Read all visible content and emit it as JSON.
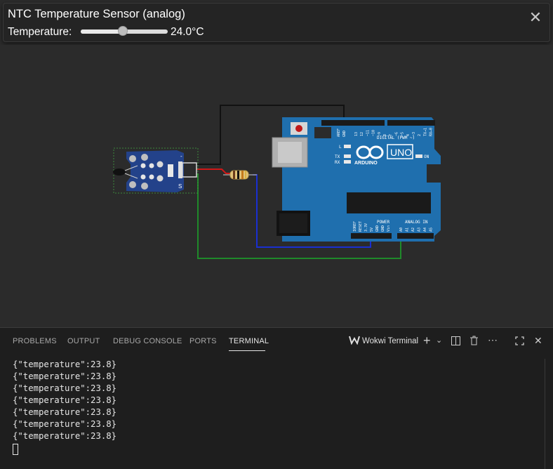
{
  "popup": {
    "title": "NTC Temperature Sensor (analog)",
    "temperature_label": "Temperature:",
    "temperature_value": "24.0°C",
    "slider_fraction": 0.48,
    "close_icon": "close-icon"
  },
  "board": {
    "brand": "ARDUINO",
    "model": "UNO",
    "digital_label": "DIGITAL (PWM ~)",
    "analog_label": "ANALOG IN",
    "power_label": "POWER",
    "aref": "AREF",
    "gnd": "GND",
    "led_l": "L",
    "led_tx": "TX",
    "led_rx": "RX",
    "on_label": "ON",
    "digital_pins": [
      "13",
      "12",
      "~11",
      "~10",
      "~9",
      "8",
      "7",
      "~6",
      "~5",
      "4",
      "~3",
      "2",
      "TX→1",
      "RX←0"
    ],
    "power_pins": [
      "IOREF",
      "RESET",
      "3.3V",
      "5V",
      "GND",
      "GND",
      "Vin"
    ],
    "analog_pins": [
      "A0",
      "A1",
      "A2",
      "A3",
      "A4",
      "A5"
    ]
  },
  "sensor_module": {
    "pin_label": "S",
    "pin_minus": "-"
  },
  "colors": {
    "board_blue": "#1f6fae",
    "module_blue": "#23428a",
    "wire_black": "#111111",
    "wire_red": "#d01818",
    "wire_blue": "#1a2fd0",
    "wire_green": "#1f8a2a"
  },
  "panel": {
    "tabs": [
      "PROBLEMS",
      "OUTPUT",
      "DEBUG CONSOLE",
      "PORTS",
      "TERMINAL"
    ],
    "active_tab": "TERMINAL",
    "terminal_name": "Wokwi Terminal",
    "terminal_lines": [
      "{\"temperature\":23.8}",
      "{\"temperature\":23.8}",
      "{\"temperature\":23.8}",
      "{\"temperature\":23.8}",
      "{\"temperature\":23.8}",
      "{\"temperature\":23.8}",
      "{\"temperature\":23.8}"
    ]
  }
}
